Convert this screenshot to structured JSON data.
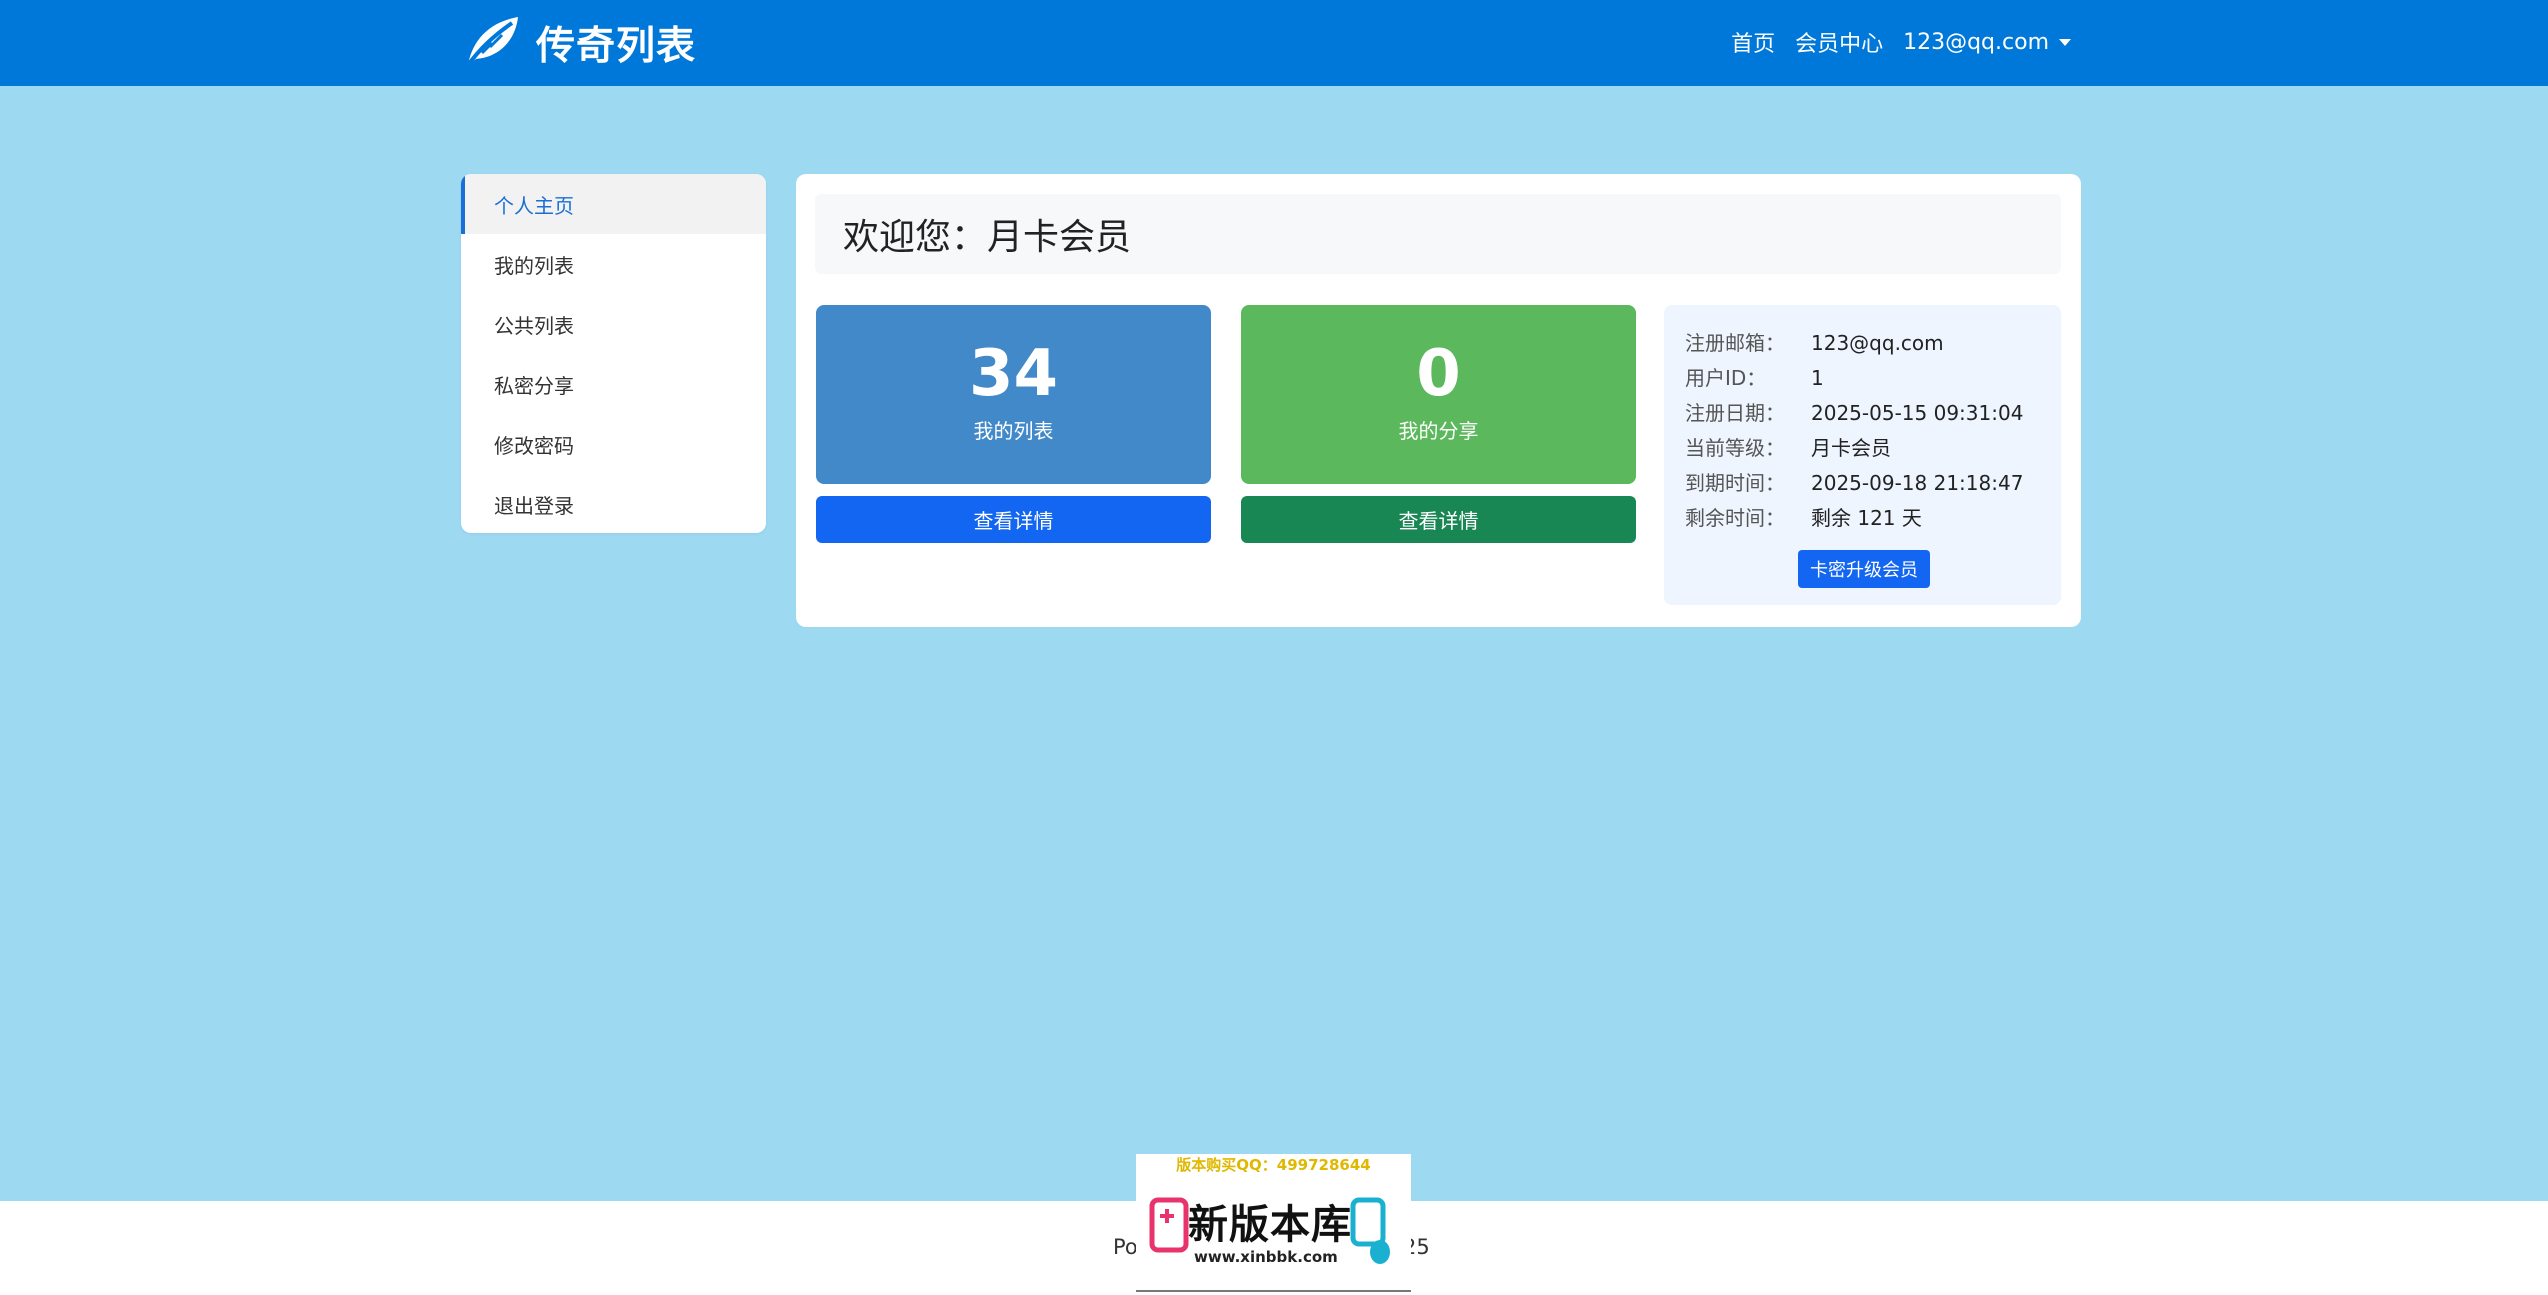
{
  "brand": {
    "name": "传奇列表",
    "icon": "leaf-icon"
  },
  "nav": {
    "home": "首页",
    "member_center": "会员中心",
    "user": "123@qq.com"
  },
  "sidebar": {
    "items": [
      {
        "label": "个人主页",
        "active": true
      },
      {
        "label": "我的列表"
      },
      {
        "label": "公共列表"
      },
      {
        "label": "私密分享"
      },
      {
        "label": "修改密码"
      },
      {
        "label": "退出登录"
      }
    ]
  },
  "main": {
    "welcome": "欢迎您：月卡会员",
    "stats": [
      {
        "value": "34",
        "label": "我的列表",
        "button": "查看详情",
        "color": "#4189c8"
      },
      {
        "value": "0",
        "label": "我的分享",
        "button": "查看详情",
        "color": "#5cb85c"
      }
    ],
    "info": {
      "rows": [
        {
          "key": "注册邮箱：",
          "value": "123@qq.com"
        },
        {
          "key": "用户ID：",
          "value": "1"
        },
        {
          "key": "注册日期：",
          "value": "2025-05-15 09:31:04"
        },
        {
          "key": "当前等级：",
          "value": "月卡会员"
        },
        {
          "key": "到期时间：",
          "value": "2025-09-18 21:18:47"
        },
        {
          "key": "剩余时间：",
          "value": "剩余 121 天"
        }
      ],
      "upgrade_button": "卡密升级会员"
    }
  },
  "footer": {
    "left": "Po",
    "right": "25"
  },
  "watermark": {
    "top_text": "版本购买QQ：499728644",
    "title": "新版本库",
    "url": "www.xinbbk.com"
  },
  "colors": {
    "navbar": "#0078d9",
    "page_bg": "#9ed9f2",
    "primary": "#1266f1",
    "success": "#198754"
  }
}
